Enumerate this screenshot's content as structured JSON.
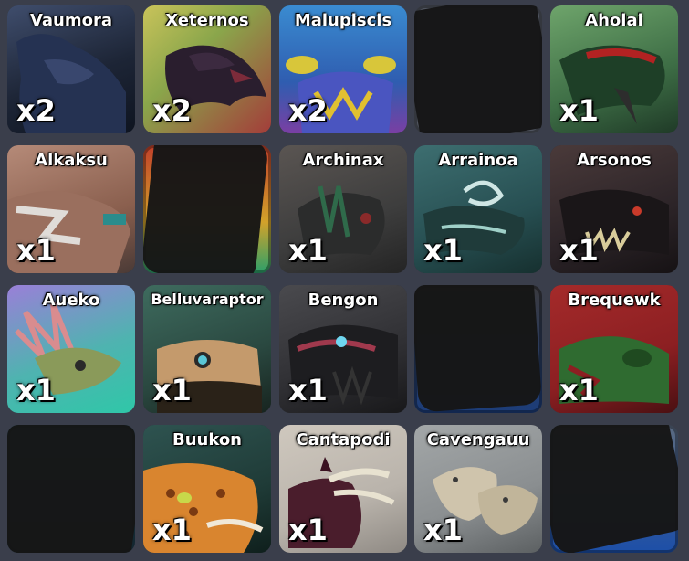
{
  "cards": [
    {
      "name": "Vaumora",
      "count": "x2",
      "bg": "#20283a",
      "accent": "#3a4c7c"
    },
    {
      "name": "Xeternos",
      "count": "x2",
      "bg": "#a5b43a",
      "accent": "#2a1e2e"
    },
    {
      "name": "Malupiscis",
      "count": "x2",
      "bg": "#2e7dc8",
      "accent": "#e1c030"
    },
    {
      "name": "",
      "count": "",
      "bg": "#505560",
      "accent": "#151515",
      "hidden": true
    },
    {
      "name": "Aholai",
      "count": "x1",
      "bg": "#3d6d45",
      "accent": "#b22222"
    },
    {
      "name": "Alkaksu",
      "count": "x1",
      "bg": "#9a6f5e",
      "accent": "#e0dcd8"
    },
    {
      "name": "",
      "count": "",
      "bg": "#b74126",
      "accent": "#151515",
      "hidden": true
    },
    {
      "name": "Archinax",
      "count": "x1",
      "bg": "#3d3d3d",
      "accent": "#2f6a4a"
    },
    {
      "name": "Arrainoa",
      "count": "x1",
      "bg": "#274f52",
      "accent": "#cfe6e4"
    },
    {
      "name": "Arsonos",
      "count": "x1",
      "bg": "#2c2428",
      "accent": "#c93a2a"
    },
    {
      "name": "Aueko",
      "count": "x1",
      "bg": "#3fb6a6",
      "accent": "#d98c8f"
    },
    {
      "name": "Belluvaraptor",
      "count": "x1",
      "bg": "#2a4840",
      "accent": "#c49a6c"
    },
    {
      "name": "Bengon",
      "count": "x1",
      "bg": "#2f2f33",
      "accent": "#a0394d"
    },
    {
      "name": "",
      "count": "",
      "bg": "#1c3d7a",
      "accent": "#151515",
      "hidden": true
    },
    {
      "name": "Brequewk",
      "count": "x1",
      "bg": "#8c1f22",
      "accent": "#2f6b30"
    },
    {
      "name": "",
      "count": "",
      "bg": "#2a6a80",
      "accent": "#151515",
      "hidden": true
    },
    {
      "name": "Buukon",
      "count": "x1",
      "bg": "#1f3b37",
      "accent": "#d9852f"
    },
    {
      "name": "Cantapodi",
      "count": "x1",
      "bg": "#b9b3ab",
      "accent": "#4a1d2c"
    },
    {
      "name": "Cavengauu",
      "count": "x1",
      "bg": "#8a8e90",
      "accent": "#cfc4ac"
    },
    {
      "name": "",
      "count": "",
      "bg": "#1d4fa8",
      "accent": "#151515",
      "hidden": true
    }
  ]
}
